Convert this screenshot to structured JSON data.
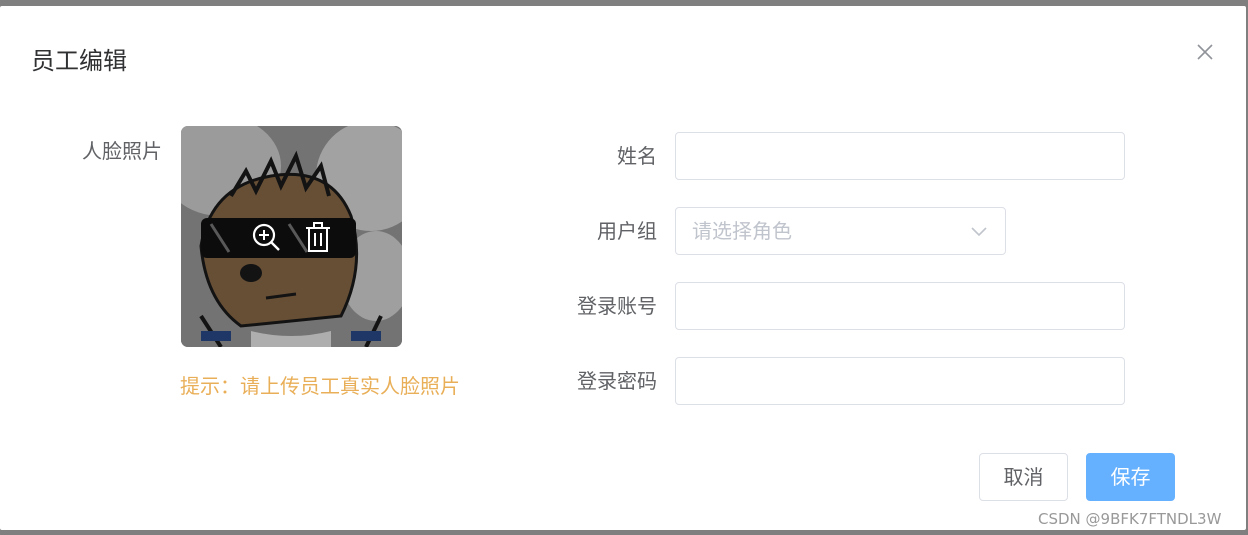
{
  "dialog": {
    "title": "员工编辑",
    "close_icon": "close-icon"
  },
  "form": {
    "photo_label": "人脸照片",
    "photo_hint": "提示：请上传员工真实人脸照片",
    "photo_actions": [
      "zoom-in-icon",
      "delete-icon"
    ],
    "name": {
      "label": "姓名",
      "value": ""
    },
    "user_group": {
      "label": "用户组",
      "placeholder": "请选择角色"
    },
    "login_account": {
      "label": "登录账号",
      "value": ""
    },
    "login_password": {
      "label": "登录密码",
      "value": ""
    }
  },
  "footer": {
    "cancel_label": "取消",
    "save_label": "保存"
  },
  "watermark": "CSDN @9BFK7FTNDL3W",
  "colors": {
    "primary": "#66b1ff",
    "hint": "#e6a23c",
    "border": "#dcdfe6",
    "overlay": "#7f7f7f"
  }
}
